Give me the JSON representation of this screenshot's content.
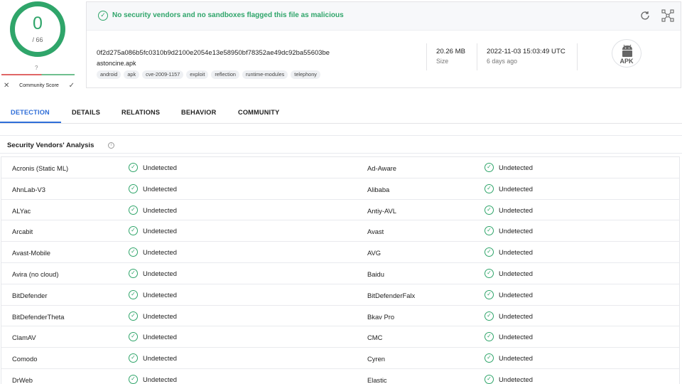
{
  "score": {
    "detections": "0",
    "total": "/ 66",
    "community_value": "?",
    "community_label": "Community Score"
  },
  "summary": {
    "banner": "No security vendors and no sandboxes flagged this file as malicious",
    "hash": "0f2d275a086b5fc0310b9d2100e2054e13e58950bf78352ae49dc92ba55603be",
    "filename": "astoncine.apk",
    "tags": [
      "android",
      "apk",
      "cve-2009-1157",
      "exploit",
      "reflection",
      "runtime-modules",
      "telephony"
    ],
    "size_value": "20.26 MB",
    "size_label": "Size",
    "date_value": "2022-11-03 15:03:49 UTC",
    "date_label": "6 days ago",
    "file_type": "APK"
  },
  "tabs": [
    "DETECTION",
    "DETAILS",
    "RELATIONS",
    "BEHAVIOR",
    "COMMUNITY"
  ],
  "section": {
    "title": "Security Vendors' Analysis"
  },
  "vendors": [
    {
      "left": "Acronis (Static ML)",
      "left_result": "Undetected",
      "right": "Ad-Aware",
      "right_result": "Undetected"
    },
    {
      "left": "AhnLab-V3",
      "left_result": "Undetected",
      "right": "Alibaba",
      "right_result": "Undetected"
    },
    {
      "left": "ALYac",
      "left_result": "Undetected",
      "right": "Antiy-AVL",
      "right_result": "Undetected"
    },
    {
      "left": "Arcabit",
      "left_result": "Undetected",
      "right": "Avast",
      "right_result": "Undetected"
    },
    {
      "left": "Avast-Mobile",
      "left_result": "Undetected",
      "right": "AVG",
      "right_result": "Undetected"
    },
    {
      "left": "Avira (no cloud)",
      "left_result": "Undetected",
      "right": "Baidu",
      "right_result": "Undetected"
    },
    {
      "left": "BitDefender",
      "left_result": "Undetected",
      "right": "BitDefenderFalx",
      "right_result": "Undetected"
    },
    {
      "left": "BitDefenderTheta",
      "left_result": "Undetected",
      "right": "Bkav Pro",
      "right_result": "Undetected"
    },
    {
      "left": "ClamAV",
      "left_result": "Undetected",
      "right": "CMC",
      "right_result": "Undetected"
    },
    {
      "left": "Comodo",
      "left_result": "Undetected",
      "right": "Cyren",
      "right_result": "Undetected"
    },
    {
      "left": "DrWeb",
      "left_result": "Undetected",
      "right": "Elastic",
      "right_result": "Undetected"
    }
  ],
  "colors": {
    "clean": "#2fa56a",
    "accent": "#2f6ed8"
  },
  "icons": {
    "banner": "check-circle-icon",
    "reload": "reload-icon",
    "graph": "graph-icon",
    "file_type": "android-icon",
    "result": "check-circle-icon"
  }
}
